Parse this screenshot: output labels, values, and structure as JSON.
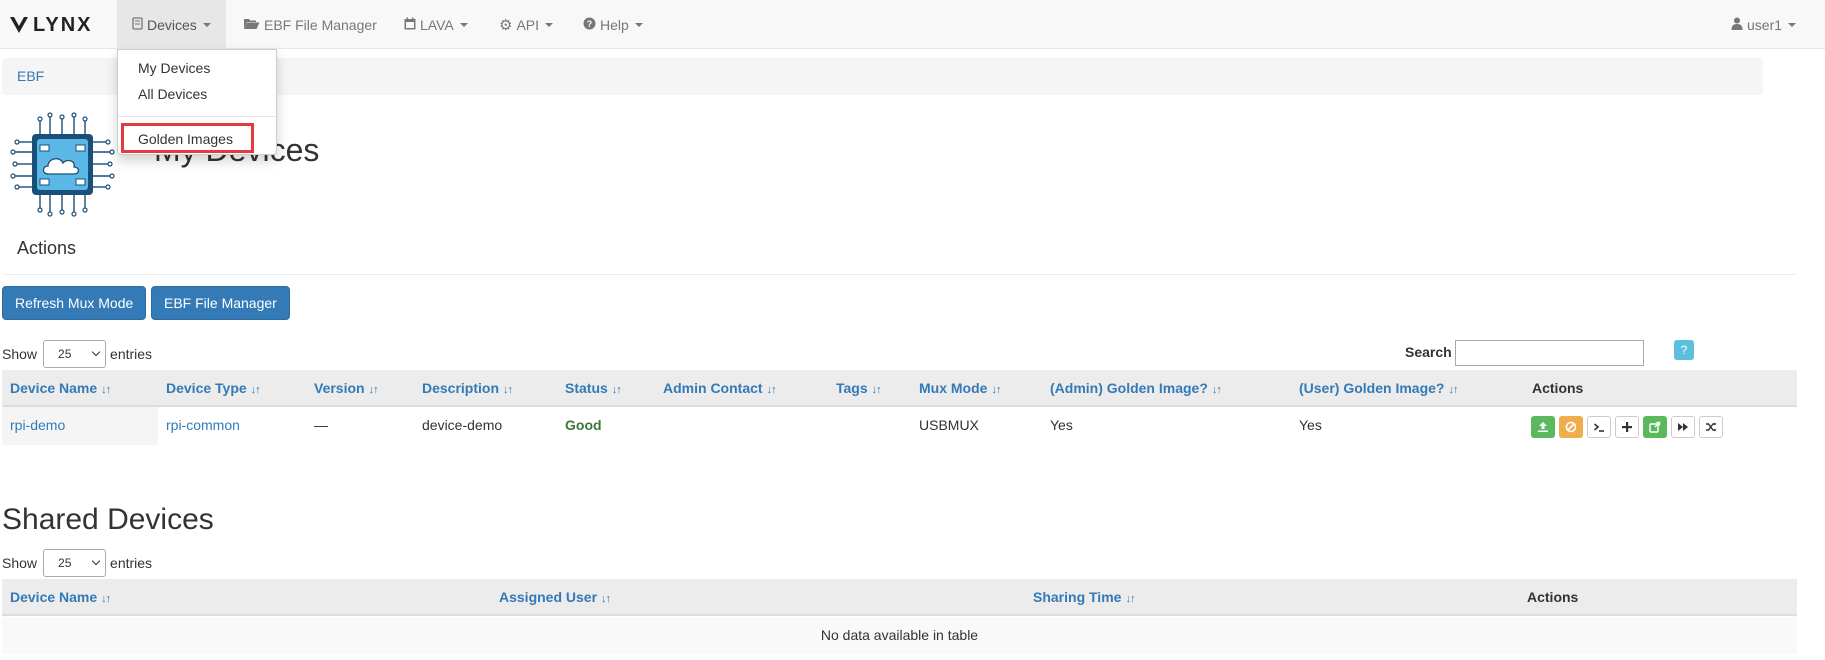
{
  "brand": {
    "name": "LYNX"
  },
  "nav": {
    "devices": "Devices",
    "ebf_file_manager": "EBF File Manager",
    "lava": "LAVA",
    "api": "API",
    "help": "Help",
    "user": "user1"
  },
  "devices_menu": {
    "items": [
      "My Devices",
      "All Devices",
      "Golden Images"
    ]
  },
  "breadcrumb": {
    "item": "EBF"
  },
  "page": {
    "title": "My Devices"
  },
  "actions": {
    "heading": "Actions",
    "refresh_button": "Refresh Mux Mode",
    "ebf_button": "EBF File Manager"
  },
  "my_devices_table": {
    "show_label": "Show",
    "page_size": "25",
    "entries_label": "entries",
    "search_label": "Search",
    "search_value": "",
    "help_label": "?",
    "sort_icon": "↓↑",
    "columns": [
      "Device Name",
      "Device Type",
      "Version",
      "Description",
      "Status",
      "Admin Contact",
      "Tags",
      "Mux Mode",
      "(Admin) Golden Image?",
      "(User) Golden Image?",
      "Actions"
    ],
    "rows": [
      {
        "device_name": "rpi-demo",
        "device_type": "rpi-common",
        "version": "—",
        "description": "device-demo",
        "status": "Good",
        "admin_contact": "",
        "tags": "",
        "mux_mode": "USBMUX",
        "admin_golden": "Yes",
        "user_golden": "Yes"
      }
    ],
    "action_icons": [
      "upload-icon",
      "ban-icon",
      "terminal-icon",
      "plus-icon",
      "share-icon",
      "forward-icon",
      "random-icon"
    ]
  },
  "shared_devices": {
    "title": "Shared Devices",
    "show_label": "Show",
    "page_size": "25",
    "entries_label": "entries",
    "columns": [
      "Device Name",
      "Assigned User",
      "Sharing Time",
      "Actions"
    ],
    "empty_message": "No data available in table"
  },
  "colors": {
    "primary": "#337ab7",
    "success": "#5cb85c",
    "warning": "#f0ad4e",
    "info": "#5bc0de",
    "highlight": "#e53940",
    "status_good": "#3c763d"
  }
}
